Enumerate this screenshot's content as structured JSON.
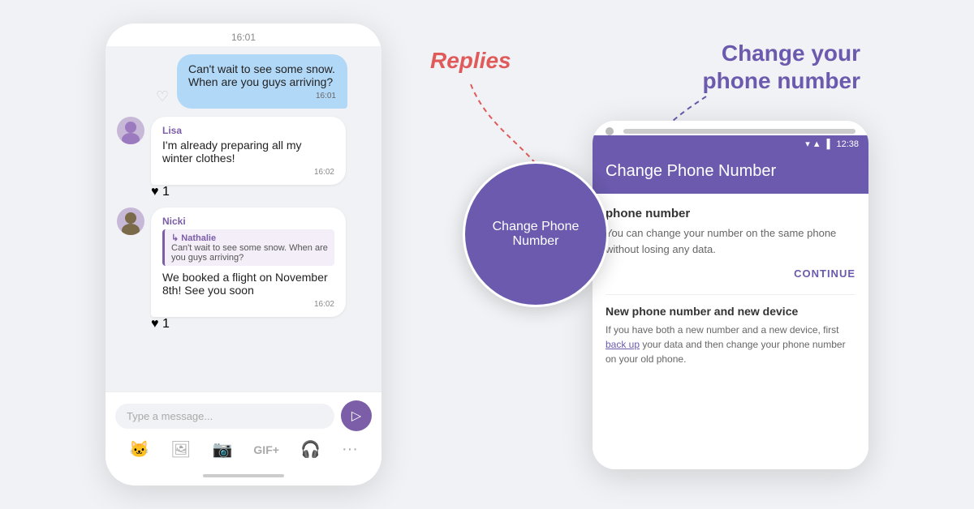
{
  "left_phone": {
    "status_time": "16:01",
    "messages": [
      {
        "type": "outgoing",
        "text": "Can't wait to see some snow. When are you guys arriving?",
        "time": "16:01"
      },
      {
        "type": "incoming",
        "sender": "Lisa",
        "text": "I'm already preparing all my winter clothes!",
        "time": "16:02",
        "heart": "1"
      },
      {
        "type": "incoming",
        "sender": "Nicki",
        "reply_sender": "Nathalie",
        "reply_text": "Can't wait to see some snow. When are you guys arriving?",
        "text": "We booked a flight on November 8th! See you soon",
        "time": "16:02",
        "heart": "1"
      }
    ],
    "input_placeholder": "Type a message...",
    "icons": [
      "🐱",
      "🖼",
      "📷",
      "GIF+",
      "🎧",
      "···"
    ]
  },
  "annotations": {
    "replies_label": "Replies",
    "change_label_line1": "Change your",
    "change_label_line2": "phone number"
  },
  "right_phone": {
    "notch": true,
    "status_time": "12:38",
    "header_title": "Change Phone Number",
    "section1_title": "phone number",
    "section1_text": "You can change your number on the same phone without losing any data.",
    "continue_label": "CONTINUE",
    "divider": true,
    "section2_title": "New phone number and new device",
    "section2_text_before": "If you have both a new number and a new device, first ",
    "section2_link": "back up",
    "section2_text_after": " your data and then change your phone number on your old phone.",
    "magnifier_text": "Change Phone Number"
  }
}
